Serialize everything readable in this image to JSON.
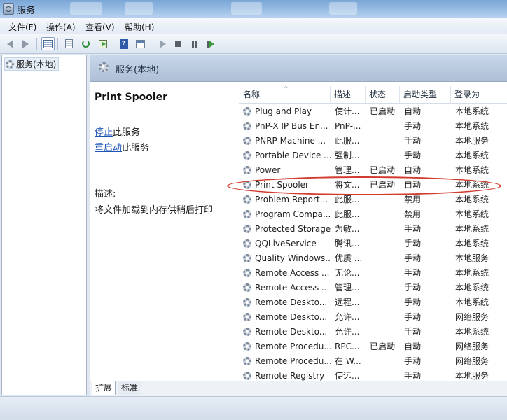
{
  "window": {
    "title": "服务"
  },
  "menu": [
    {
      "label": "文件(F)"
    },
    {
      "label": "操作(A)"
    },
    {
      "label": "查看(V)"
    },
    {
      "label": "帮助(H)"
    }
  ],
  "toolbar": {
    "icons": [
      "back-arrow-icon",
      "forward-arrow-icon",
      "show-hide-tree-icon",
      "properties-list-icon",
      "refresh-icon",
      "export-list-icon",
      "help-icon",
      "properties-icon",
      "start-service-icon",
      "stop-service-icon",
      "pause-service-icon",
      "restart-service-icon"
    ]
  },
  "tree": {
    "root_label": "服务(本地)"
  },
  "pane_header": {
    "title": "服务(本地)"
  },
  "detail": {
    "service_name": "Print Spooler",
    "stop_link": "停止",
    "stop_suffix": "此服务",
    "restart_link": "重启动",
    "restart_suffix": "此服务",
    "desc_label": "描述:",
    "desc_text": "将文件加载到内存供稍后打印"
  },
  "table": {
    "columns": [
      "名称",
      "描述",
      "状态",
      "启动类型",
      "登录为"
    ],
    "sort_indicator": "^",
    "rows": [
      {
        "name": "Plug and Play",
        "desc": "使计...",
        "status": "已启动",
        "start": "自动",
        "logon": "本地系统"
      },
      {
        "name": "PnP-X IP Bus En...",
        "desc": "PnP-...",
        "status": "",
        "start": "手动",
        "logon": "本地系统"
      },
      {
        "name": "PNRP Machine ...",
        "desc": "此服...",
        "status": "",
        "start": "手动",
        "logon": "本地服务"
      },
      {
        "name": "Portable Device ...",
        "desc": "强制...",
        "status": "",
        "start": "手动",
        "logon": "本地系统"
      },
      {
        "name": "Power",
        "desc": "管理...",
        "status": "已启动",
        "start": "自动",
        "logon": "本地系统"
      },
      {
        "name": "Print Spooler",
        "desc": "将文...",
        "status": "已启动",
        "start": "自动",
        "logon": "本地系统"
      },
      {
        "name": "Problem Report...",
        "desc": "此服...",
        "status": "",
        "start": "禁用",
        "logon": "本地系统"
      },
      {
        "name": "Program Compa...",
        "desc": "此服...",
        "status": "",
        "start": "禁用",
        "logon": "本地系统"
      },
      {
        "name": "Protected Storage",
        "desc": "为敏...",
        "status": "",
        "start": "手动",
        "logon": "本地系统"
      },
      {
        "name": "QQLiveService",
        "desc": "腾讯...",
        "status": "",
        "start": "手动",
        "logon": "本地系统"
      },
      {
        "name": "Quality Windows...",
        "desc": "优质 ...",
        "status": "",
        "start": "手动",
        "logon": "本地服务"
      },
      {
        "name": "Remote Access ...",
        "desc": "无论...",
        "status": "",
        "start": "手动",
        "logon": "本地系统"
      },
      {
        "name": "Remote Access ...",
        "desc": "管理...",
        "status": "",
        "start": "手动",
        "logon": "本地系统"
      },
      {
        "name": "Remote Deskto...",
        "desc": "远程...",
        "status": "",
        "start": "手动",
        "logon": "本地系统"
      },
      {
        "name": "Remote Deskto...",
        "desc": "允许...",
        "status": "",
        "start": "手动",
        "logon": "网络服务"
      },
      {
        "name": "Remote Deskto...",
        "desc": "允许...",
        "status": "",
        "start": "手动",
        "logon": "本地系统"
      },
      {
        "name": "Remote Procedu...",
        "desc": "RPC...",
        "status": "已启动",
        "start": "自动",
        "logon": "网络服务"
      },
      {
        "name": "Remote Procedu...",
        "desc": "在 W...",
        "status": "",
        "start": "手动",
        "logon": "网络服务"
      },
      {
        "name": "Remote Registry",
        "desc": "使远...",
        "status": "",
        "start": "手动",
        "logon": "本地服务"
      }
    ]
  },
  "tabs": [
    {
      "label": "扩展"
    },
    {
      "label": "标准"
    }
  ],
  "colors": {
    "annotation": "#d33a2f",
    "link": "#1e55b3"
  }
}
